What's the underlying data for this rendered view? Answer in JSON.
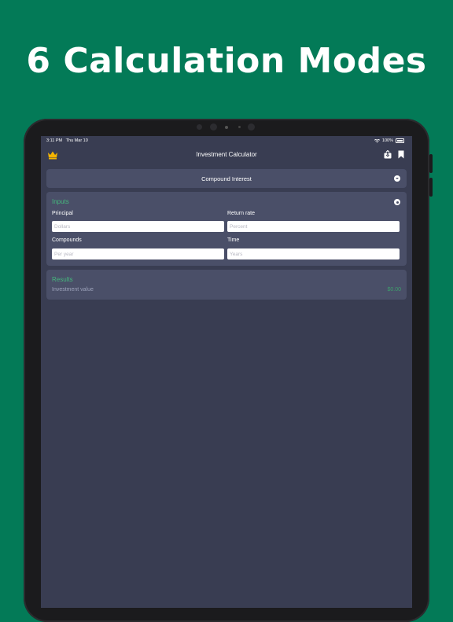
{
  "headline": "6 Calculation Modes",
  "status": {
    "time": "3:11 PM",
    "date": "Thu Mar 10",
    "battery": "100%"
  },
  "nav": {
    "title": "Investment Calculator"
  },
  "mode": {
    "selected": "Compound Interest"
  },
  "inputs": {
    "title": "Inputs",
    "principal": {
      "label": "Principal",
      "placeholder": "Dollars"
    },
    "return_rate": {
      "label": "Return rate",
      "placeholder": "Percent"
    },
    "compounds": {
      "label": "Compounds",
      "placeholder": "Per year"
    },
    "time": {
      "label": "Time",
      "placeholder": "Years"
    }
  },
  "results": {
    "title": "Results",
    "label": "Investment value",
    "value": "$0.00"
  },
  "colors": {
    "background": "#037a57",
    "screen": "#393d52",
    "card": "#4a4f68",
    "accent": "#45b77d",
    "crown": "#f5b400"
  },
  "icons": [
    "crown-icon",
    "share-icon",
    "bookmark-icon",
    "chevron-down-icon",
    "gear-icon",
    "wifi-icon",
    "battery-icon"
  ]
}
